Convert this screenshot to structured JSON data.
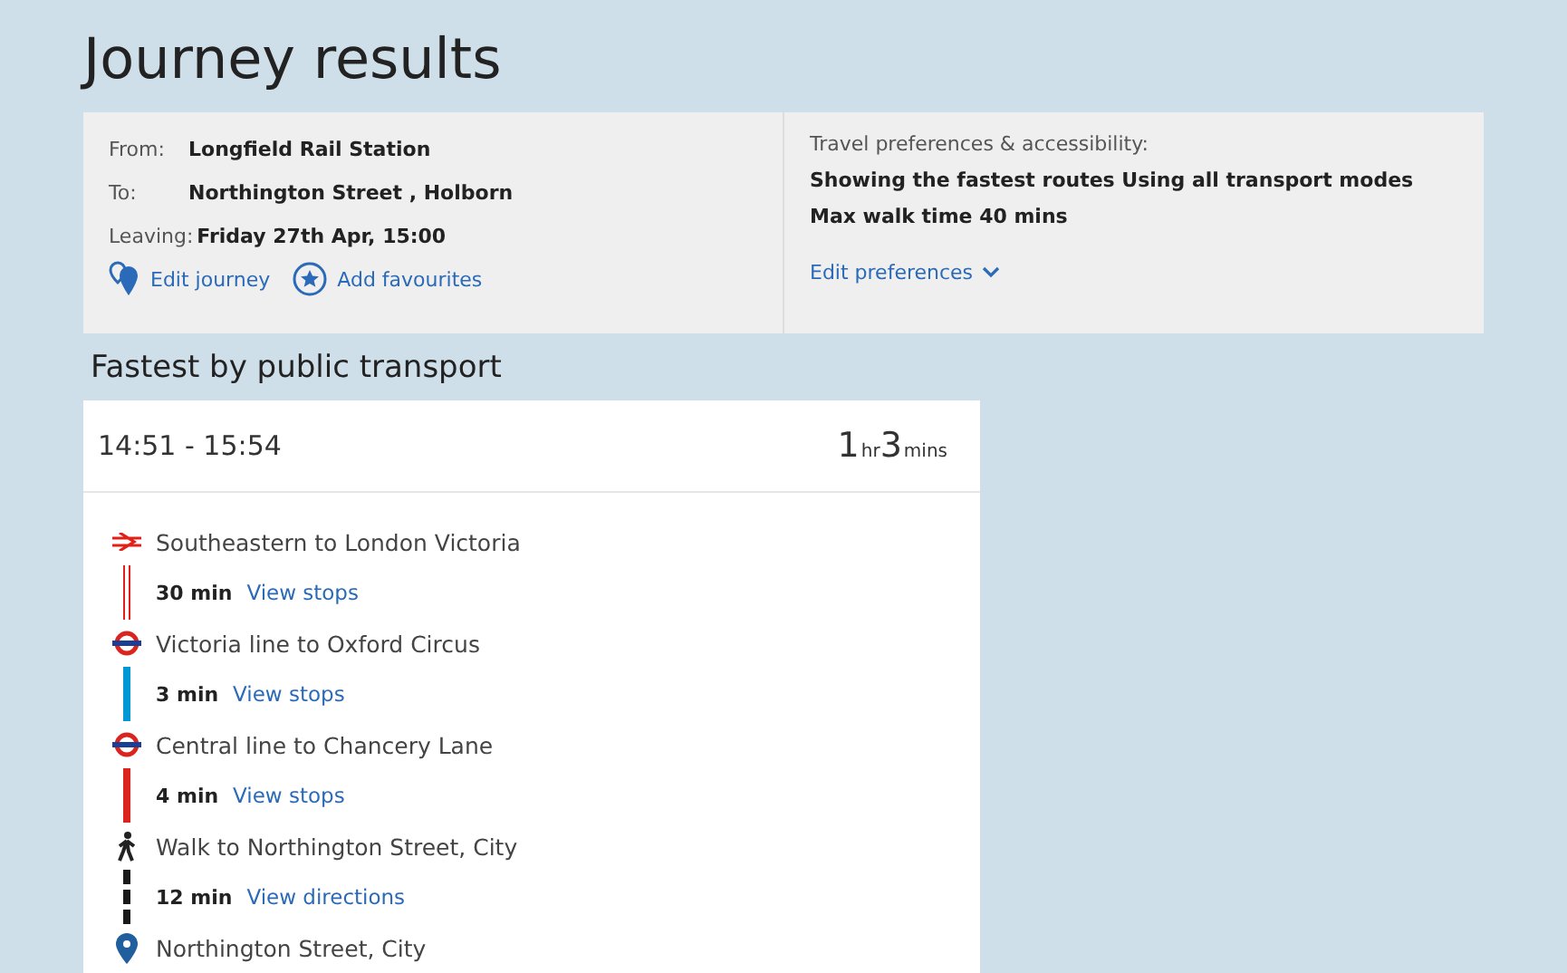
{
  "title": "Journey results",
  "summary": {
    "from_label": "From:",
    "from": "Longfield Rail Station",
    "to_label": "To:",
    "to": "Northington Street , Holborn",
    "leaving_label": "Leaving:",
    "leaving": "Friday 27th Apr, 15:00",
    "links": [
      {
        "kind": "edit",
        "label": "Edit journey"
      },
      {
        "kind": "favourite",
        "label": "Add favourites"
      }
    ]
  },
  "preferences": {
    "heading": "Travel preferences & accessibility:",
    "text": "Showing the fastest routes Using all transport modes Max walk time 40 mins",
    "link": "Edit preferences"
  },
  "section_heading": "Fastest by public transport",
  "journey": {
    "times": "14:51 - 15:54",
    "duration": [
      {
        "value": "1",
        "unit": "hr"
      },
      {
        "value": "3",
        "unit": "mins"
      }
    ],
    "legs": [
      {
        "kind": "rail",
        "title": "Southeastern to London Victoria",
        "duration": "30 min",
        "link": "View stops",
        "color": "#e32017"
      },
      {
        "kind": "tube",
        "title": "Victoria line to Oxford Circus",
        "duration": "3 min",
        "link": "View stops",
        "color": "#0098d4"
      },
      {
        "kind": "tube",
        "title": "Central line to Chancery Lane",
        "duration": "4 min",
        "link": "View stops",
        "color": "#dc241f"
      },
      {
        "kind": "walk",
        "title": "Walk to Northington Street, City",
        "duration": "12 min",
        "link": "View directions",
        "color": "#1a1a1a"
      },
      {
        "kind": "destination",
        "title": "Northington Street, City"
      }
    ]
  }
}
